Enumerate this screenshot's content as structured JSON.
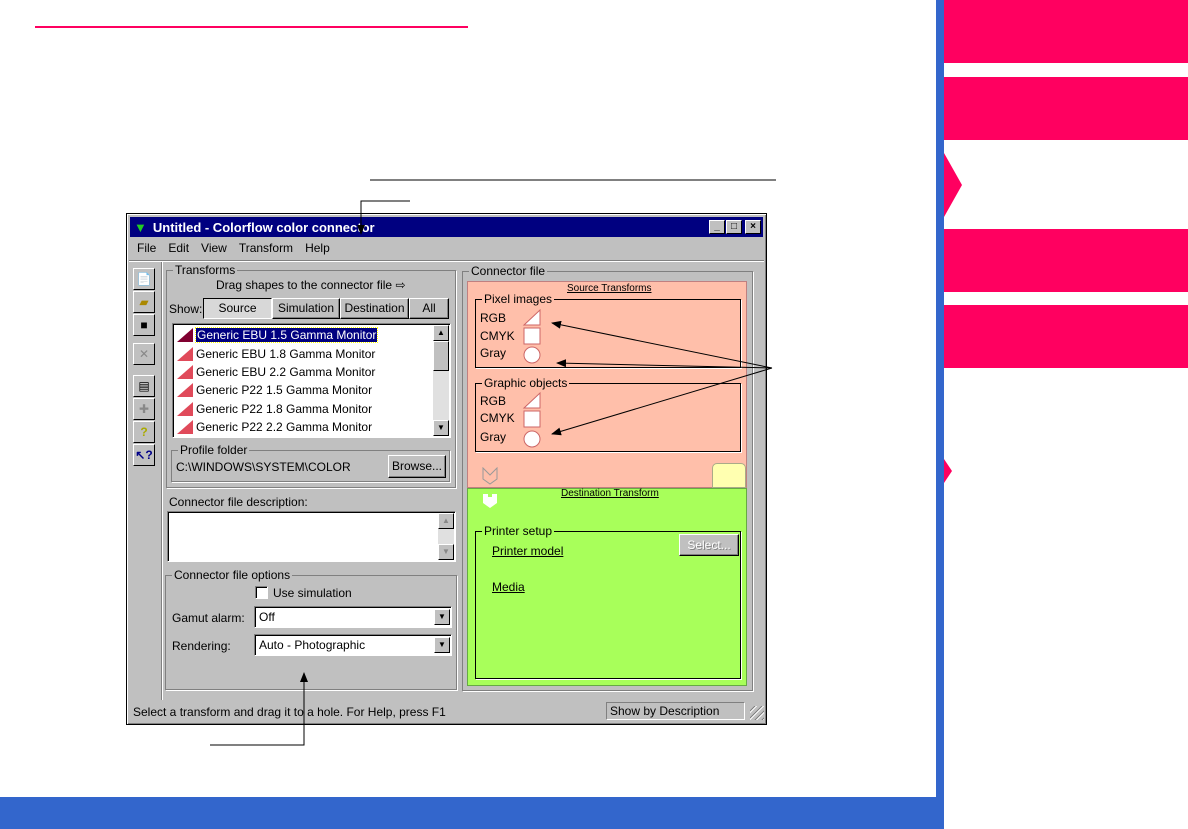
{
  "window": {
    "title": "Untitled - Colorflow color connector",
    "min": "_",
    "max": "□",
    "close": "×"
  },
  "menu": [
    "File",
    "Edit",
    "View",
    "Transform",
    "Help"
  ],
  "toolbar": [
    "new-icon",
    "open-icon",
    "save-icon",
    "delete-icon",
    "properties-icon",
    "transform-icon",
    "help-icon",
    "context-help-icon"
  ],
  "transforms": {
    "legend": "Transforms",
    "hint": "Drag shapes to the connector file",
    "show_label": "Show:",
    "tabs": [
      "Source",
      "Simulation",
      "Destination",
      "All"
    ],
    "items": [
      "Generic EBU 1.5 Gamma Monitor",
      "Generic EBU 1.8 Gamma Monitor",
      "Generic EBU 2.2 Gamma Monitor",
      "Generic P22 1.5 Gamma Monitor",
      "Generic P22 1.8 Gamma Monitor",
      "Generic P22 2.2 Gamma Monitor"
    ]
  },
  "profile": {
    "legend": "Profile folder",
    "path": "C:\\WINDOWS\\SYSTEM\\COLOR",
    "browse": "Browse..."
  },
  "description": {
    "label": "Connector file description:"
  },
  "options": {
    "legend": "Connector file options",
    "use_sim": "Use simulation",
    "gamut_label": "Gamut alarm:",
    "gamut_value": "Off",
    "render_label": "Rendering:",
    "render_value": "Auto - Photographic"
  },
  "connector": {
    "legend": "Connector file",
    "source_title": "Source Transforms",
    "pixel_legend": "Pixel images",
    "graphic_legend": "Graphic objects",
    "slots": [
      "RGB",
      "CMYK",
      "Gray"
    ],
    "dest_title": "Destination Transform",
    "printer_legend": "Printer setup",
    "printer_model": "Printer model",
    "media": "Media",
    "select": "Select..."
  },
  "status": {
    "text": "Select a transform and drag it to a hole. For Help, press F1",
    "right": "Show by Description"
  },
  "colors": {
    "accent": "#ff0060",
    "blue": "#3366cc",
    "source_bg": "#ffbfaa",
    "dest_bg": "#a8ff5a"
  }
}
